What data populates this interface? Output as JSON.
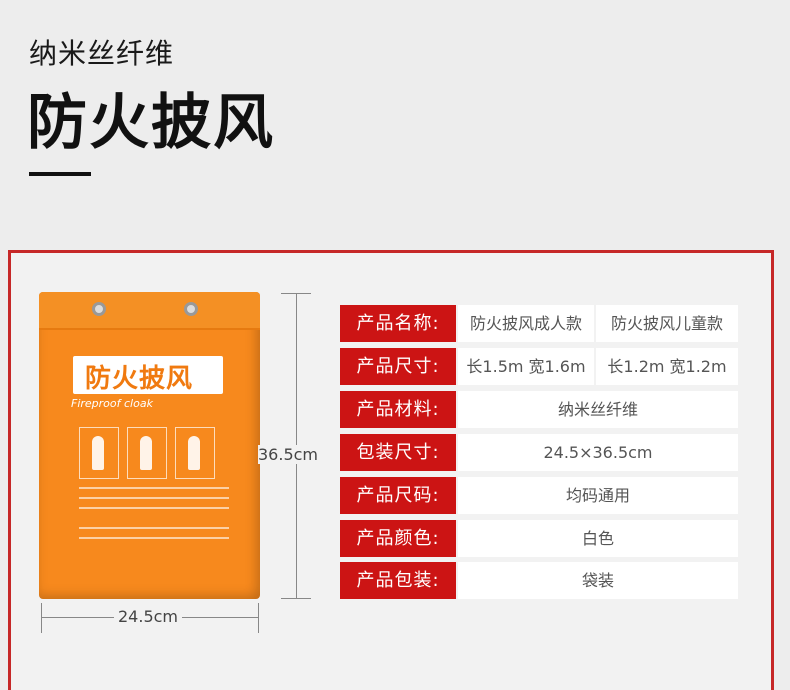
{
  "header": {
    "subtitle": "纳米丝纤维",
    "title": "防火披风"
  },
  "product_image": {
    "label_cn": "防火披风",
    "label_en": "Fireproof cloak"
  },
  "dimensions": {
    "height": "36.5cm",
    "width": "24.5cm"
  },
  "specs": [
    {
      "label": "产品名称:",
      "values": [
        "防火披风成人款",
        "防火披风儿童款"
      ]
    },
    {
      "label": "产品尺寸:",
      "values": [
        "长1.5m 宽1.6m",
        "长1.2m 宽1.2m"
      ]
    },
    {
      "label": "产品材料:",
      "values": [
        "纳米丝纤维"
      ]
    },
    {
      "label": "包装尺寸:",
      "values": [
        "24.5×36.5cm"
      ]
    },
    {
      "label": "产品尺码:",
      "values": [
        "均码通用"
      ]
    },
    {
      "label": "产品颜色:",
      "values": [
        "白色"
      ]
    },
    {
      "label": "产品包装:",
      "values": [
        "袋装"
      ]
    }
  ],
  "colors": {
    "accent_red": "#cc1414",
    "bag_orange": "#f7891d"
  }
}
